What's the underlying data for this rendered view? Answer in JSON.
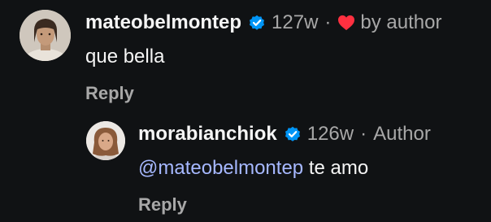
{
  "comments": [
    {
      "username": "mateobelmontep",
      "verified": true,
      "time": "127w",
      "separator": "·",
      "liked_by_author": true,
      "liked_label": "by author",
      "text": "que bella",
      "reply_label": "Reply",
      "icons": [
        "avatar",
        "verified-badge-icon",
        "heart-icon"
      ]
    },
    {
      "username": "morabianchiok",
      "verified": true,
      "time": "126w",
      "separator": "·",
      "author_label": "Author",
      "mention": "@mateobelmontep",
      "text": " te amo",
      "reply_label": "Reply",
      "icons": [
        "avatar",
        "verified-badge-icon"
      ]
    }
  ],
  "colors": {
    "background": "#101214",
    "primary_text": "#f5f5f5",
    "secondary_text": "#a8a8a8",
    "mention": "#a6b8ff",
    "verified": "#0095f6",
    "heart": "#ff3040"
  }
}
